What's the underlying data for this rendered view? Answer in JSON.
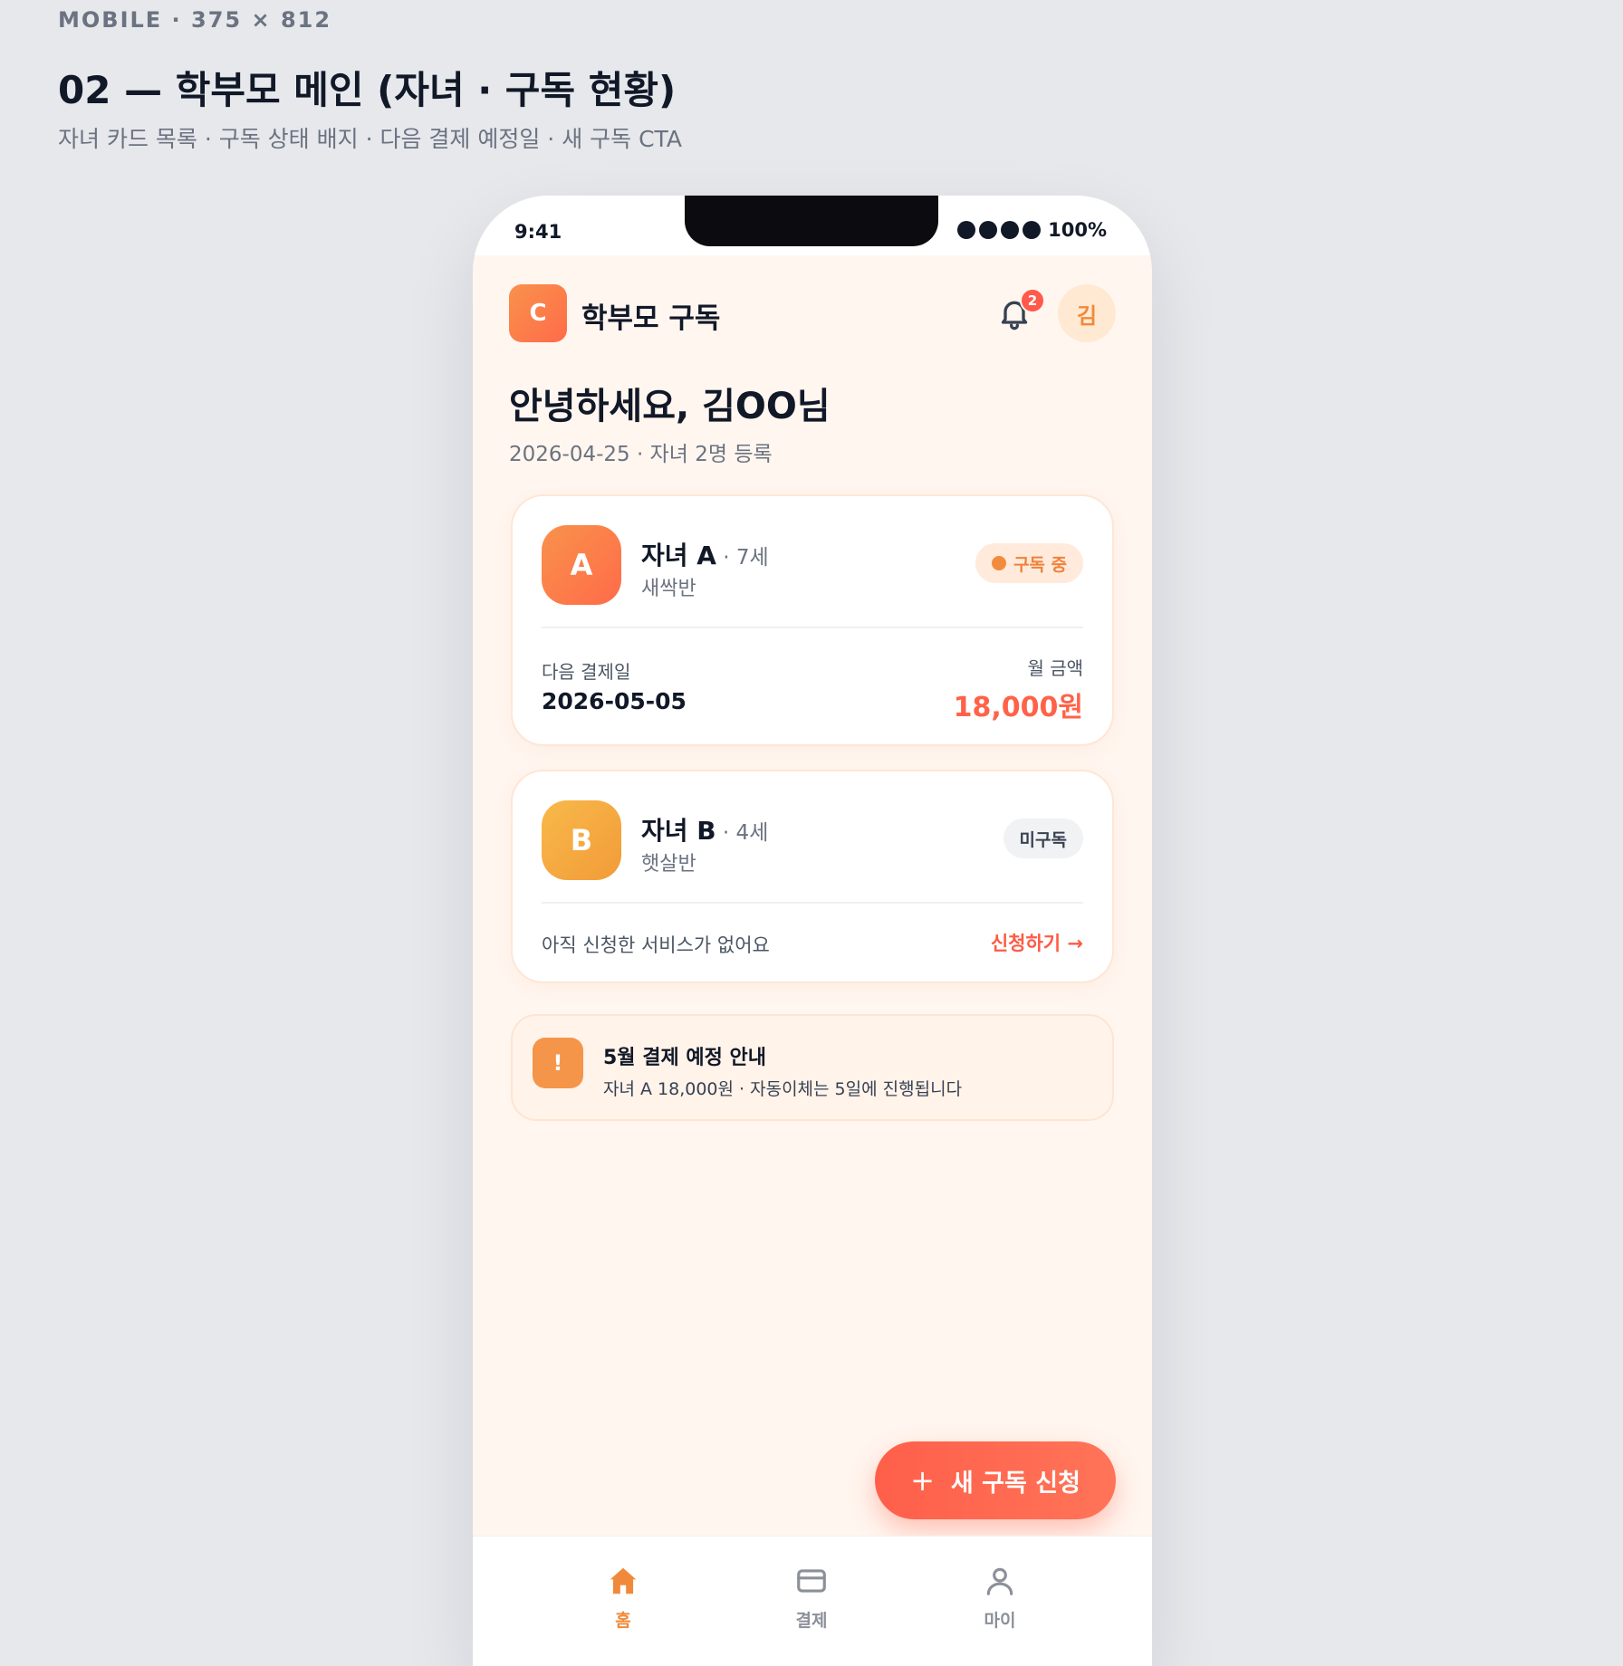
{
  "spec": {
    "label": "MOBILE · 375 × 812",
    "title": "02 — 학부모 메인 (자녀 · 구독 현황)",
    "subtitle": "자녀 카드 목록 · 구독 상태 배지 · 다음 결제 예정일 · 새 구독 CTA"
  },
  "status_bar": {
    "time": "9:41",
    "battery": "100%"
  },
  "header": {
    "logo_letter": "C",
    "title": "학부모 구독",
    "notification_count": "2",
    "avatar_initial": "김"
  },
  "greeting": {
    "title": "안녕하세요, 김OO님",
    "subtitle": "2026-04-25 · 자녀 2명 등록"
  },
  "children": [
    {
      "initial": "A",
      "name": "자녀 A",
      "age": " · 7세",
      "class": "새싹반",
      "status": "구독 중",
      "next_payment_label": "다음 결제일",
      "next_payment_date": "2026-05-05",
      "amount_label": "월 금액",
      "amount": "18,000원"
    },
    {
      "initial": "B",
      "name": "자녀 B",
      "age": " · 4세",
      "class": "햇살반",
      "status": "미구독",
      "empty_text": "아직 신청한 서비스가 없어요",
      "apply_label": "신청하기 →"
    }
  ],
  "notice": {
    "icon": "!",
    "title": "5월 결제 예정 안내",
    "text": "자녀 A 18,000원 · 자동이체는 5일에 진행됩니다"
  },
  "fab": {
    "icon": "+",
    "label": "새 구독 신청"
  },
  "nav": [
    {
      "label": "홈",
      "icon": "home-icon",
      "active": true
    },
    {
      "label": "결제",
      "icon": "card-icon",
      "active": false
    },
    {
      "label": "마이",
      "icon": "user-icon",
      "active": false
    }
  ],
  "colors": {
    "accent": "#ff6248",
    "brand_orange": "#f08a3a",
    "background": "#fff6ef"
  }
}
